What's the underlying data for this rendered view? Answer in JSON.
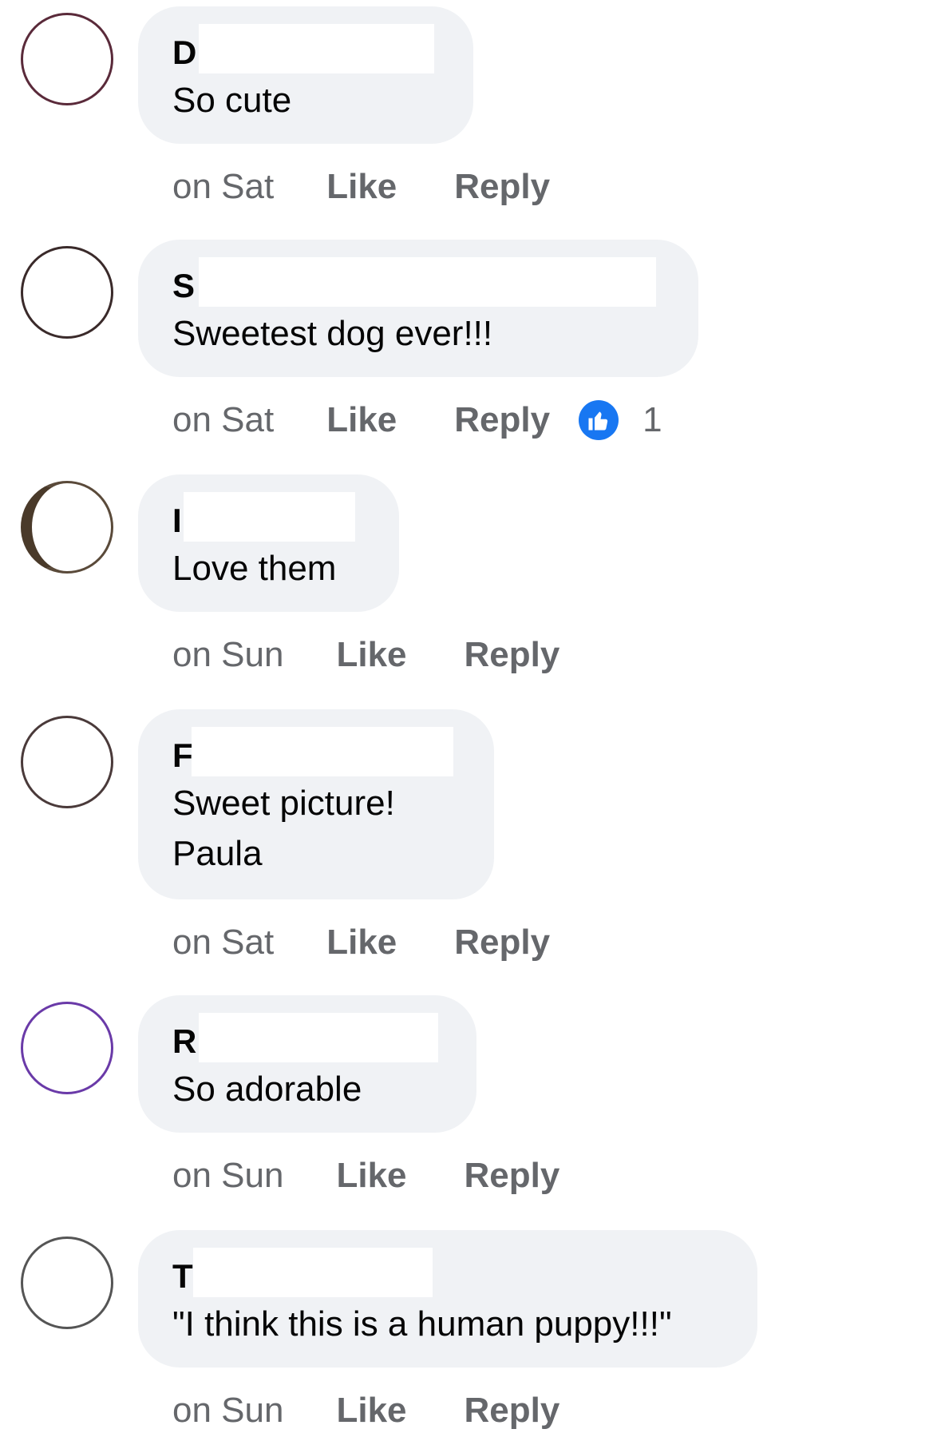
{
  "comments": [
    {
      "author_visible": "D",
      "text": "So cute",
      "time": "on Sat",
      "like_label": "Like",
      "reply_label": "Reply",
      "avatar_color": "#5a2a3a"
    },
    {
      "author_visible": "S",
      "text": "Sweetest dog ever!!!",
      "time": "on Sat",
      "like_label": "Like",
      "reply_label": "Reply",
      "reaction_icon": "like-icon",
      "reaction_count": "1",
      "avatar_color": "#3a2a2a"
    },
    {
      "author_visible": "I",
      "text": "Love them",
      "time": "on Sun",
      "like_label": "Like",
      "reply_label": "Reply",
      "avatar_color": "#5a4a3a"
    },
    {
      "author_visible": "F",
      "text": "Sweet picture!\nPaula",
      "time": "on Sat",
      "like_label": "Like",
      "reply_label": "Reply",
      "avatar_color": "#4a3a3a"
    },
    {
      "author_visible": "R",
      "text": "So adorable",
      "time": "on Sun",
      "like_label": "Like",
      "reply_label": "Reply",
      "avatar_color": "#6a3aa8"
    },
    {
      "author_visible": "T",
      "text": "\"I think this is a human puppy!!!\"",
      "time": "on Sun",
      "like_label": "Like",
      "reply_label": "Reply",
      "avatar_color": "#555555"
    }
  ],
  "colors": {
    "bubble_bg": "#f0f2f5",
    "meta_text": "#65676b",
    "like_badge": "#1877f2"
  }
}
